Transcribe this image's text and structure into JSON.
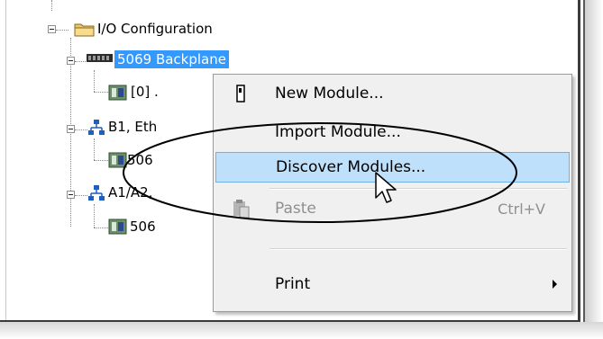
{
  "tree": {
    "io_config_label": "I/O Configuration",
    "backplane_label": "5069 Backplane",
    "slot0_label": "[0] .",
    "b1_label": "B1, Eth",
    "b1_module_label": "506",
    "a1a2_label": "A1/A2,",
    "a1a2_module_label": "506"
  },
  "context_menu": {
    "new_module": "New Module...",
    "import_module": "Import Module...",
    "discover_modules": "Discover Modules...",
    "paste": "Paste",
    "paste_shortcut": "Ctrl+V",
    "print": "Print"
  }
}
